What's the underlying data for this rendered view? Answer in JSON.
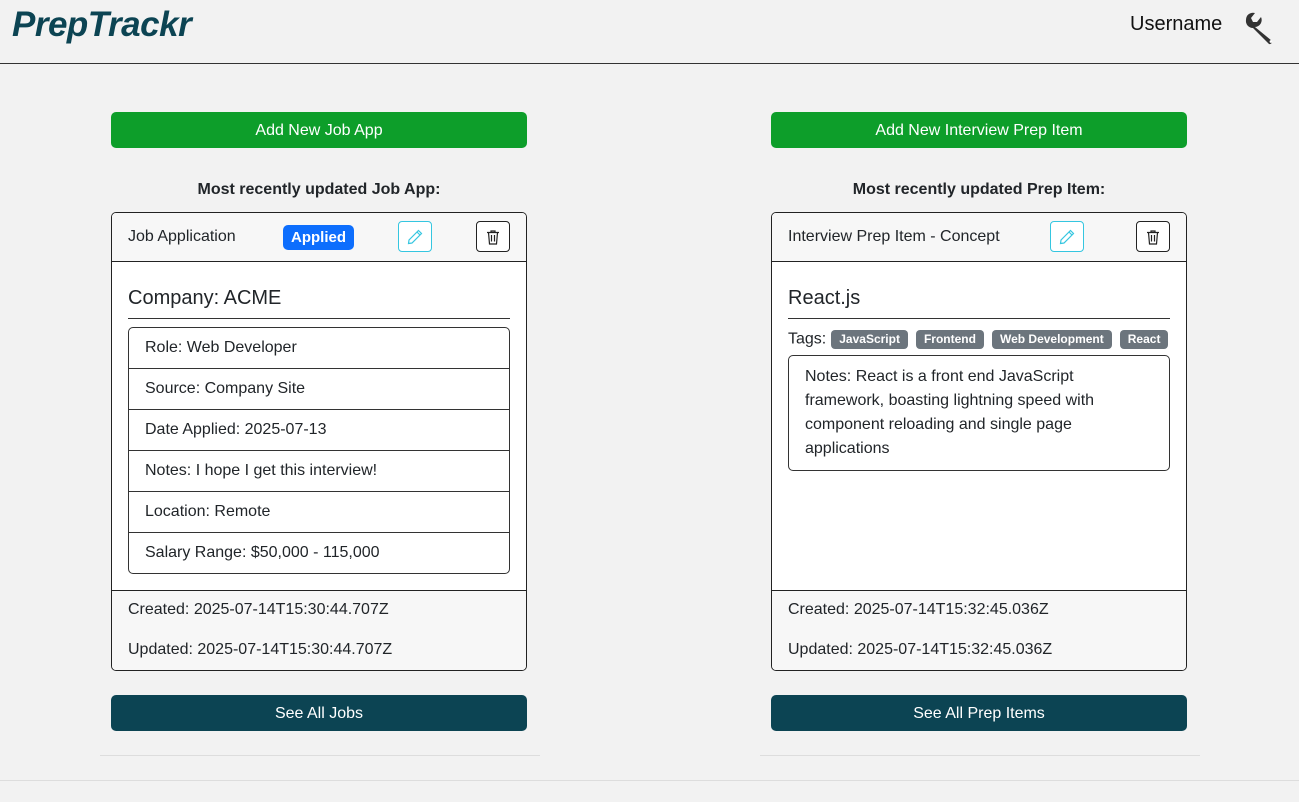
{
  "header": {
    "brand": "PrepTrackr",
    "username": "Username"
  },
  "job": {
    "add_button": "Add New Job App",
    "recent_title": "Most recently updated Job App:",
    "card_type": "Job Application",
    "status": "Applied",
    "company": "Company: ACME",
    "details": [
      "Role: Web Developer",
      "Source: Company Site",
      "Date Applied: 2025-07-13",
      "Notes: I hope I get this interview!",
      "Location: Remote",
      "Salary Range: $50,000 - 115,000"
    ],
    "created": "Created: 2025-07-14T15:30:44.707Z",
    "updated": "Updated: 2025-07-14T15:30:44.707Z",
    "see_all": "See All Jobs"
  },
  "prep": {
    "add_button": "Add New Interview Prep Item",
    "recent_title": "Most recently updated Prep Item:",
    "card_type": "Interview Prep Item - Concept",
    "title": "React.js",
    "tags_label": "Tags:",
    "tags": [
      "JavaScript",
      "Frontend",
      "Web Development",
      "React"
    ],
    "notes": "Notes: React is a front end JavaScript framework, boasting lightning speed with component reloading and single page applications",
    "created": "Created: 2025-07-14T15:32:45.036Z",
    "updated": "Updated: 2025-07-14T15:32:45.036Z",
    "see_all": "See All Prep Items"
  },
  "icons": {
    "settings": "wrench-icon",
    "edit": "pencil-icon",
    "delete": "trash-icon"
  },
  "colors": {
    "brand": "#0c4453",
    "add_button": "#0d9e2a",
    "status_badge": "#0d6efd",
    "tag": "#6c757d",
    "edit_border": "#35c6e0"
  }
}
